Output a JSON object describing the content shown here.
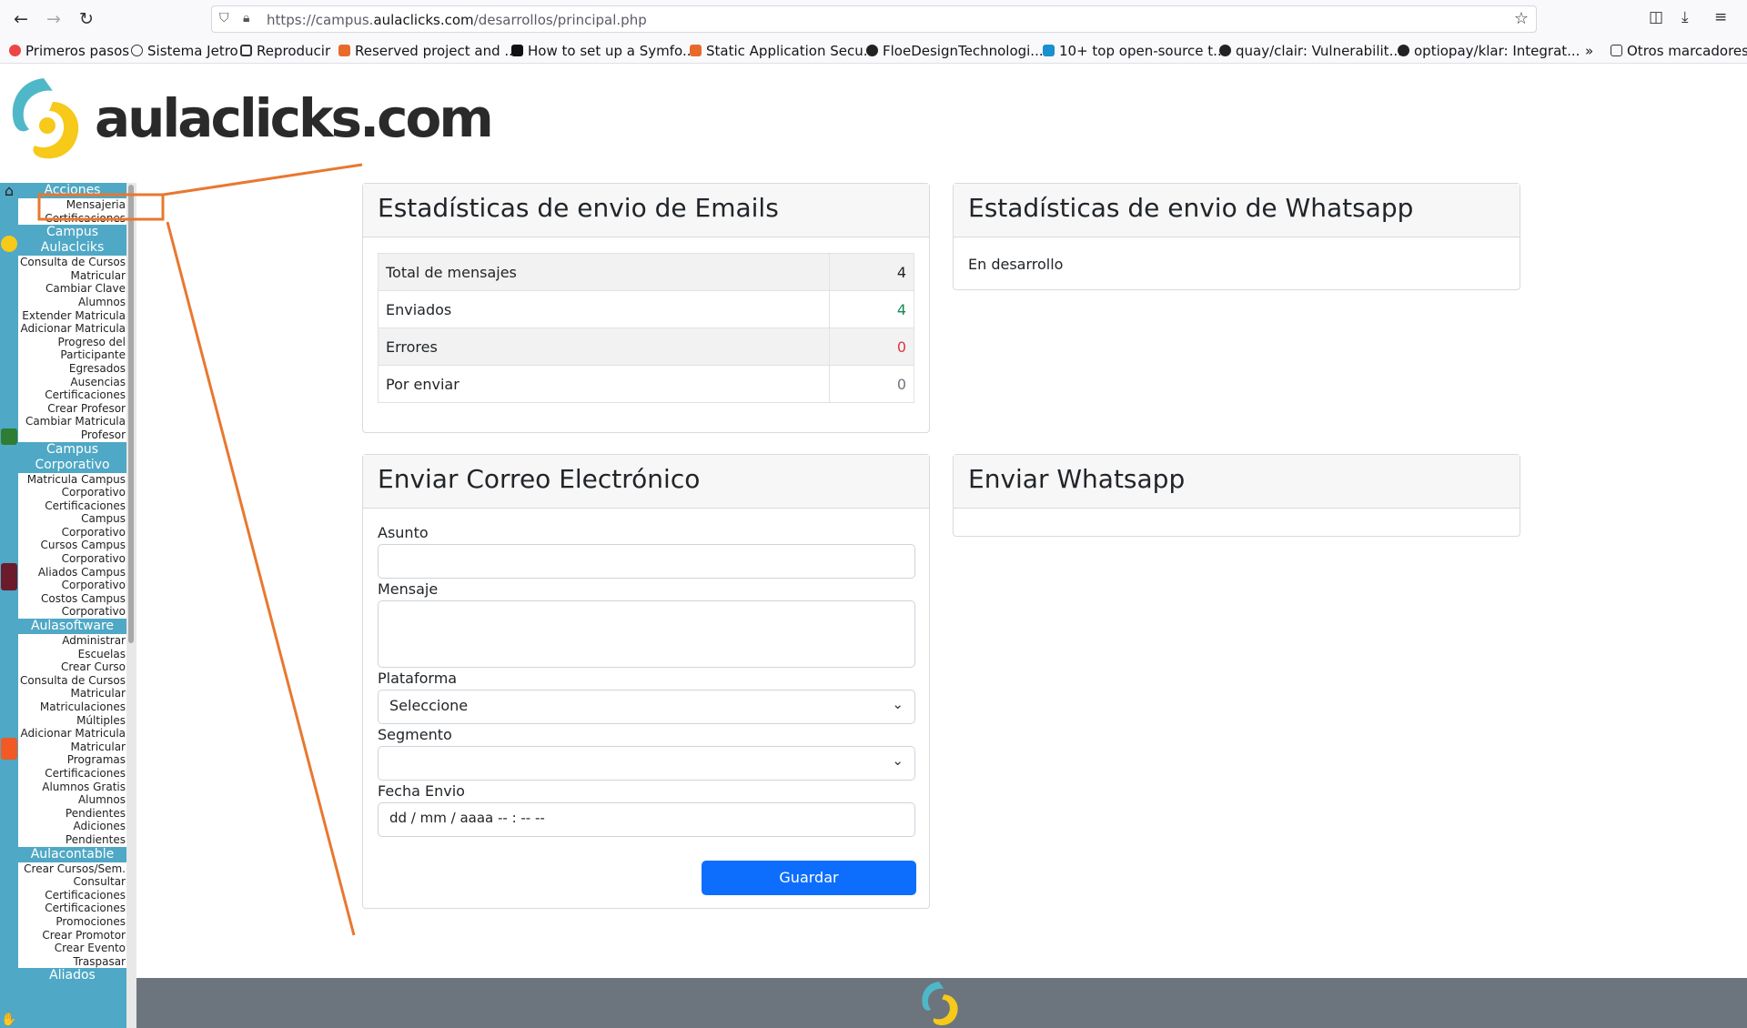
{
  "browser": {
    "url_prefix": "https://campus.",
    "url_domain": "aulaclicks.com",
    "url_path": "/desarrollos/principal.php",
    "bookmarks": [
      "Primeros pasos",
      "Sistema Jetro",
      "Reproducir",
      "Reserved project and ...",
      "How to set up a Symfo...",
      "Static Application Secu...",
      "FloeDesignTechnologi...",
      "10+ top open-source t...",
      "quay/clair: Vulnerabilit...",
      "optiopay/klar: Integrat..."
    ],
    "other_bookmarks": "Otros marcadores"
  },
  "logo_text": "aulaclicks.com",
  "sidebar": [
    {
      "head": "Acciones",
      "items": [
        "Mensajeria",
        "Certificaciones"
      ]
    },
    {
      "head": "Campus Aulaclciks",
      "items": [
        "Consulta de Cursos",
        "Matricular",
        "Cambiar Clave",
        "Alumnos",
        "Extender Matricula",
        "Adicionar Matricula",
        "Progreso del",
        "Participante",
        "Egresados",
        "Ausencias",
        "Certificaciones",
        "Crear Profesor",
        "Cambiar Matricula",
        "Profesor"
      ]
    },
    {
      "head": "Campus Corporativo",
      "items": [
        "Matricula Campus",
        "Corporativo",
        "Certificaciones",
        "Campus Corporativo",
        "Cursos Campus",
        "Corporativo",
        "Aliados Campus",
        "Corporativo",
        "Costos Campus",
        "Corporativo"
      ]
    },
    {
      "head": "Aulasoftware",
      "items": [
        "Administrar Escuelas",
        "Crear Curso",
        "Consulta de Cursos",
        "Matricular",
        "Matriculaciones",
        "Múltiples",
        "Adicionar Matricula",
        "Matricular Programas",
        "Certificaciones",
        "Alumnos Gratis",
        "Alumnos Pendientes",
        "Adiciones Pendientes"
      ]
    },
    {
      "head": "Aulacontable",
      "items": [
        "Crear Cursos/Sem.",
        "Consultar",
        "Certificaciones",
        "Certificaciones",
        "Promociones",
        "Crear Promotor",
        "Crear Evento",
        "Traspasar"
      ]
    },
    {
      "head": "Aliados",
      "items": []
    }
  ],
  "email_stats": {
    "title": "Estadísticas de envio de Emails",
    "rows": [
      {
        "label": "Total de mensajes",
        "value": "4",
        "color": "#212529"
      },
      {
        "label": "Enviados",
        "value": "4",
        "color": "#198754"
      },
      {
        "label": "Errores",
        "value": "0",
        "color": "#dc3545"
      },
      {
        "label": "Por enviar",
        "value": "0",
        "color": "#6c757d"
      }
    ]
  },
  "whatsapp_stats": {
    "title": "Estadísticas de envio de Whatsapp",
    "body": "En desarrollo"
  },
  "email_form": {
    "title": "Enviar Correo Electrónico",
    "asunto_label": "Asunto",
    "mensaje_label": "Mensaje",
    "plataforma_label": "Plataforma",
    "plataforma_value": "Seleccione",
    "segmento_label": "Segmento",
    "segmento_value": "",
    "fecha_label": "Fecha Envio",
    "fecha_placeholder": "dd / mm / aaaa  -- : --  --",
    "save_label": "Guardar"
  },
  "whatsapp_form": {
    "title": "Enviar Whatsapp"
  },
  "annotation_color": "#e8782f"
}
